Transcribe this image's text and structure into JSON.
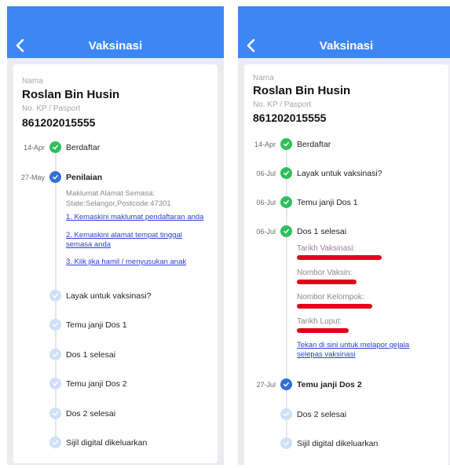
{
  "left": {
    "header": {
      "title": "Vaksinasi"
    },
    "profile": {
      "name_label": "Nama",
      "name": "Roslan Bin Husin",
      "ic_label": "No. KP / Pasport",
      "ic": "861202015555"
    },
    "steps": [
      {
        "date": "14-Apr",
        "label": "Berdaftar",
        "status": "done"
      },
      {
        "date": "27-May",
        "label": "Penilaian",
        "status": "current"
      },
      {
        "date": "",
        "label": "Layak untuk vaksinasi?",
        "status": "pending"
      },
      {
        "date": "",
        "label": "Temu janji Dos 1",
        "status": "pending"
      },
      {
        "date": "",
        "label": "Dos 1 selesai",
        "status": "pending"
      },
      {
        "date": "",
        "label": "Temu janji Dos 2",
        "status": "pending"
      },
      {
        "date": "",
        "label": "Dos 2 selesai",
        "status": "pending"
      },
      {
        "date": "",
        "label": "Sijil digital dikeluarkan",
        "status": "pending"
      }
    ],
    "assessment": {
      "address_title": "Maklumat Alamat Semasa:",
      "address_value": "State:Selangor,Postcode:47301",
      "links": [
        "1. Kemaskini maklumat pendaftaran anda",
        "2. Kemaskini alamat tempat tinggal",
        "semasa anda",
        "3. Klik jika hamil / menyusukan anak"
      ]
    }
  },
  "right": {
    "header": {
      "title": "Vaksinasi"
    },
    "profile": {
      "name_label": "Nama",
      "name": "Roslan Bin Husin",
      "ic_label": "No. KP / Pasport",
      "ic": "861202015555"
    },
    "steps": [
      {
        "date": "14-Apr",
        "label": "Berdaftar",
        "status": "done"
      },
      {
        "date": "06-Jul",
        "label": "Layak untuk vaksinasi?",
        "status": "done"
      },
      {
        "date": "06-Jul",
        "label": "Temu janji Dos 1",
        "status": "done"
      },
      {
        "date": "06-Jul",
        "label": "Dos 1 selesai",
        "status": "done"
      },
      {
        "date": "27-Jul",
        "label": "Temu janji Dos 2",
        "status": "current"
      },
      {
        "date": "",
        "label": "Dos 2 selesai",
        "status": "pending"
      },
      {
        "date": "",
        "label": "Sijil digital dikeluarkan",
        "status": "pending"
      }
    ],
    "dose1_details": {
      "fields": [
        "Tarikh Vaksinasi:",
        "Nombor Vaksin:",
        "Nombor Kelompok:",
        "Tarikh Luput:"
      ],
      "report_link": [
        "Tekan di sini untuk melapor gejala",
        "selepas vaksinasi"
      ]
    }
  },
  "colors": {
    "header": "#3d87f4",
    "done": "#2fbe5d",
    "current": "#2f6fd8",
    "pending": "#cfe0f7",
    "link": "#2a3fd0",
    "redaction": "#e3001b"
  },
  "icons": {
    "back": "chevron-left-icon",
    "step": "check-icon"
  }
}
